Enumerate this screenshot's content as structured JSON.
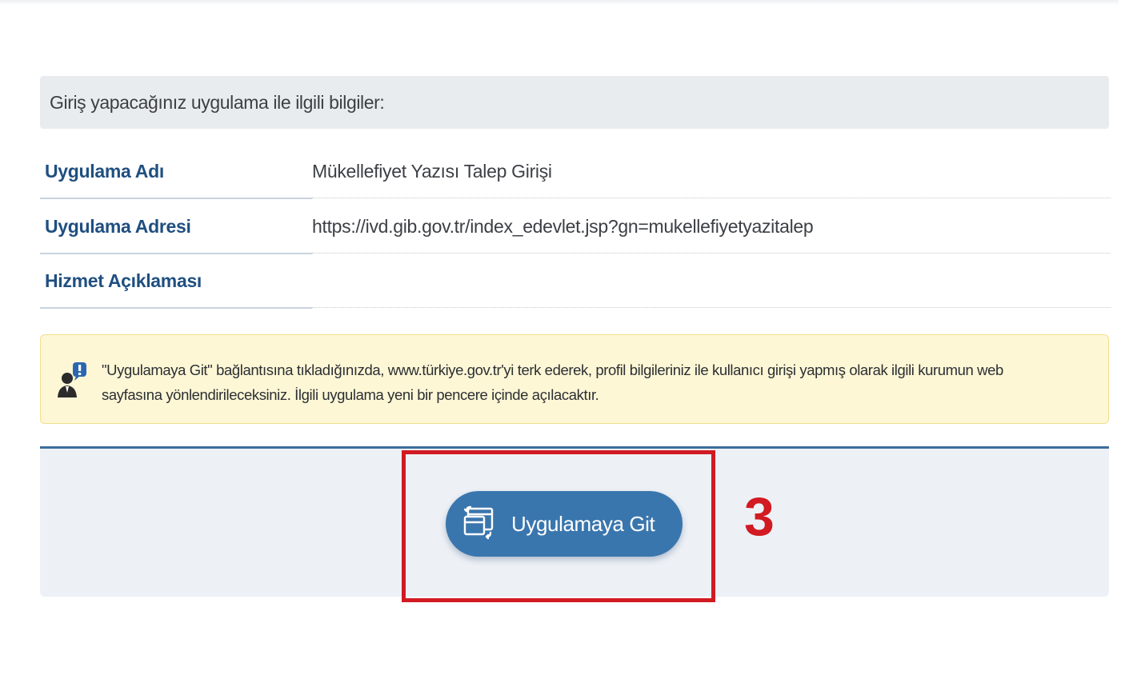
{
  "section_header": {
    "title": "Giriş yapacağınız uygulama ile ilgili bilgiler:"
  },
  "info": {
    "rows": [
      {
        "label": "Uygulama Adı",
        "value": "Mükellefiyet Yazısı Talep Girişi"
      },
      {
        "label": "Uygulama Adresi",
        "value": "https://ivd.gib.gov.tr/index_edevlet.jsp?gn=mukellefiyetyazitalep"
      },
      {
        "label": "Hizmet Açıklaması",
        "value": ""
      }
    ]
  },
  "notice": {
    "icon": "user-info-icon",
    "line1": "\"Uygulamaya Git\" bağlantısına tıkladığınızda, www.türkiye.gov.tr'yi terk ederek, profil bilgileriniz ile kullanıcı girişi yapmış olarak ilgili kurumun web",
    "line2": "sayfasına yönlendirileceksiniz. İlgili uygulama yeni bir pencere içinde açılacaktır."
  },
  "action": {
    "button_label": "Uygulamaya Git",
    "button_icon": "new-window-switch-icon"
  },
  "annotation": {
    "step_number": "3",
    "color": "#d11a22"
  },
  "colors": {
    "label_blue": "#1f4f80",
    "button_blue": "#3a76ae",
    "notice_bg": "#fdf7d6",
    "panel_bg": "#edf1f6"
  }
}
